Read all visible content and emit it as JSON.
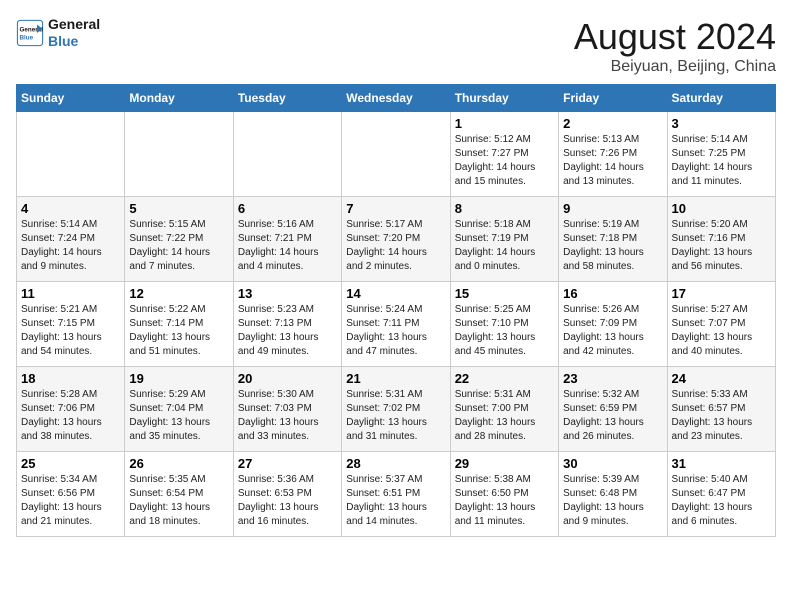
{
  "header": {
    "logo_line1": "General",
    "logo_line2": "Blue",
    "month": "August 2024",
    "location": "Beiyuan, Beijing, China"
  },
  "columns": [
    "Sunday",
    "Monday",
    "Tuesday",
    "Wednesday",
    "Thursday",
    "Friday",
    "Saturday"
  ],
  "weeks": [
    [
      {
        "day": "",
        "info": ""
      },
      {
        "day": "",
        "info": ""
      },
      {
        "day": "",
        "info": ""
      },
      {
        "day": "",
        "info": ""
      },
      {
        "day": "1",
        "info": "Sunrise: 5:12 AM\nSunset: 7:27 PM\nDaylight: 14 hours\nand 15 minutes."
      },
      {
        "day": "2",
        "info": "Sunrise: 5:13 AM\nSunset: 7:26 PM\nDaylight: 14 hours\nand 13 minutes."
      },
      {
        "day": "3",
        "info": "Sunrise: 5:14 AM\nSunset: 7:25 PM\nDaylight: 14 hours\nand 11 minutes."
      }
    ],
    [
      {
        "day": "4",
        "info": "Sunrise: 5:14 AM\nSunset: 7:24 PM\nDaylight: 14 hours\nand 9 minutes."
      },
      {
        "day": "5",
        "info": "Sunrise: 5:15 AM\nSunset: 7:22 PM\nDaylight: 14 hours\nand 7 minutes."
      },
      {
        "day": "6",
        "info": "Sunrise: 5:16 AM\nSunset: 7:21 PM\nDaylight: 14 hours\nand 4 minutes."
      },
      {
        "day": "7",
        "info": "Sunrise: 5:17 AM\nSunset: 7:20 PM\nDaylight: 14 hours\nand 2 minutes."
      },
      {
        "day": "8",
        "info": "Sunrise: 5:18 AM\nSunset: 7:19 PM\nDaylight: 14 hours\nand 0 minutes."
      },
      {
        "day": "9",
        "info": "Sunrise: 5:19 AM\nSunset: 7:18 PM\nDaylight: 13 hours\nand 58 minutes."
      },
      {
        "day": "10",
        "info": "Sunrise: 5:20 AM\nSunset: 7:16 PM\nDaylight: 13 hours\nand 56 minutes."
      }
    ],
    [
      {
        "day": "11",
        "info": "Sunrise: 5:21 AM\nSunset: 7:15 PM\nDaylight: 13 hours\nand 54 minutes."
      },
      {
        "day": "12",
        "info": "Sunrise: 5:22 AM\nSunset: 7:14 PM\nDaylight: 13 hours\nand 51 minutes."
      },
      {
        "day": "13",
        "info": "Sunrise: 5:23 AM\nSunset: 7:13 PM\nDaylight: 13 hours\nand 49 minutes."
      },
      {
        "day": "14",
        "info": "Sunrise: 5:24 AM\nSunset: 7:11 PM\nDaylight: 13 hours\nand 47 minutes."
      },
      {
        "day": "15",
        "info": "Sunrise: 5:25 AM\nSunset: 7:10 PM\nDaylight: 13 hours\nand 45 minutes."
      },
      {
        "day": "16",
        "info": "Sunrise: 5:26 AM\nSunset: 7:09 PM\nDaylight: 13 hours\nand 42 minutes."
      },
      {
        "day": "17",
        "info": "Sunrise: 5:27 AM\nSunset: 7:07 PM\nDaylight: 13 hours\nand 40 minutes."
      }
    ],
    [
      {
        "day": "18",
        "info": "Sunrise: 5:28 AM\nSunset: 7:06 PM\nDaylight: 13 hours\nand 38 minutes."
      },
      {
        "day": "19",
        "info": "Sunrise: 5:29 AM\nSunset: 7:04 PM\nDaylight: 13 hours\nand 35 minutes."
      },
      {
        "day": "20",
        "info": "Sunrise: 5:30 AM\nSunset: 7:03 PM\nDaylight: 13 hours\nand 33 minutes."
      },
      {
        "day": "21",
        "info": "Sunrise: 5:31 AM\nSunset: 7:02 PM\nDaylight: 13 hours\nand 31 minutes."
      },
      {
        "day": "22",
        "info": "Sunrise: 5:31 AM\nSunset: 7:00 PM\nDaylight: 13 hours\nand 28 minutes."
      },
      {
        "day": "23",
        "info": "Sunrise: 5:32 AM\nSunset: 6:59 PM\nDaylight: 13 hours\nand 26 minutes."
      },
      {
        "day": "24",
        "info": "Sunrise: 5:33 AM\nSunset: 6:57 PM\nDaylight: 13 hours\nand 23 minutes."
      }
    ],
    [
      {
        "day": "25",
        "info": "Sunrise: 5:34 AM\nSunset: 6:56 PM\nDaylight: 13 hours\nand 21 minutes."
      },
      {
        "day": "26",
        "info": "Sunrise: 5:35 AM\nSunset: 6:54 PM\nDaylight: 13 hours\nand 18 minutes."
      },
      {
        "day": "27",
        "info": "Sunrise: 5:36 AM\nSunset: 6:53 PM\nDaylight: 13 hours\nand 16 minutes."
      },
      {
        "day": "28",
        "info": "Sunrise: 5:37 AM\nSunset: 6:51 PM\nDaylight: 13 hours\nand 14 minutes."
      },
      {
        "day": "29",
        "info": "Sunrise: 5:38 AM\nSunset: 6:50 PM\nDaylight: 13 hours\nand 11 minutes."
      },
      {
        "day": "30",
        "info": "Sunrise: 5:39 AM\nSunset: 6:48 PM\nDaylight: 13 hours\nand 9 minutes."
      },
      {
        "day": "31",
        "info": "Sunrise: 5:40 AM\nSunset: 6:47 PM\nDaylight: 13 hours\nand 6 minutes."
      }
    ]
  ]
}
